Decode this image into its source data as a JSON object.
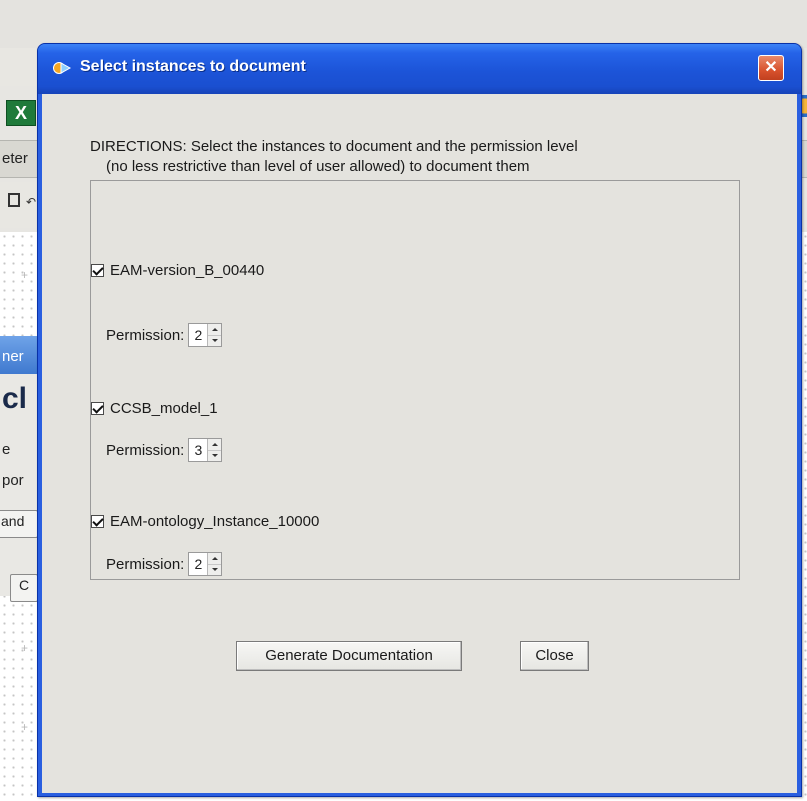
{
  "background_app": {
    "fragments": [
      "eter",
      "ner",
      "cl",
      "e",
      "por",
      "and",
      "C"
    ]
  },
  "dialog": {
    "title": "Select instances to document",
    "close_glyph": "✕",
    "directions_line1": "DIRECTIONS: Select the instances to document and the permission level",
    "directions_line2": "(no less restrictive than level of user allowed) to document them",
    "permission_label": "Permission:",
    "instances": [
      {
        "name": "EAM-version_B_00440",
        "checked": true,
        "permission": "2"
      },
      {
        "name": "CCSB_model_1",
        "checked": true,
        "permission": "3"
      },
      {
        "name": "EAM-ontology_Instance_10000",
        "checked": true,
        "permission": "2"
      }
    ],
    "buttons": {
      "generate": "Generate Documentation",
      "close": "Close"
    }
  },
  "colors": {
    "titlebar": "#1c54d8",
    "frame": "#2a5fe0",
    "client_bg": "#e4e3de",
    "close_button": "#d8522d"
  }
}
